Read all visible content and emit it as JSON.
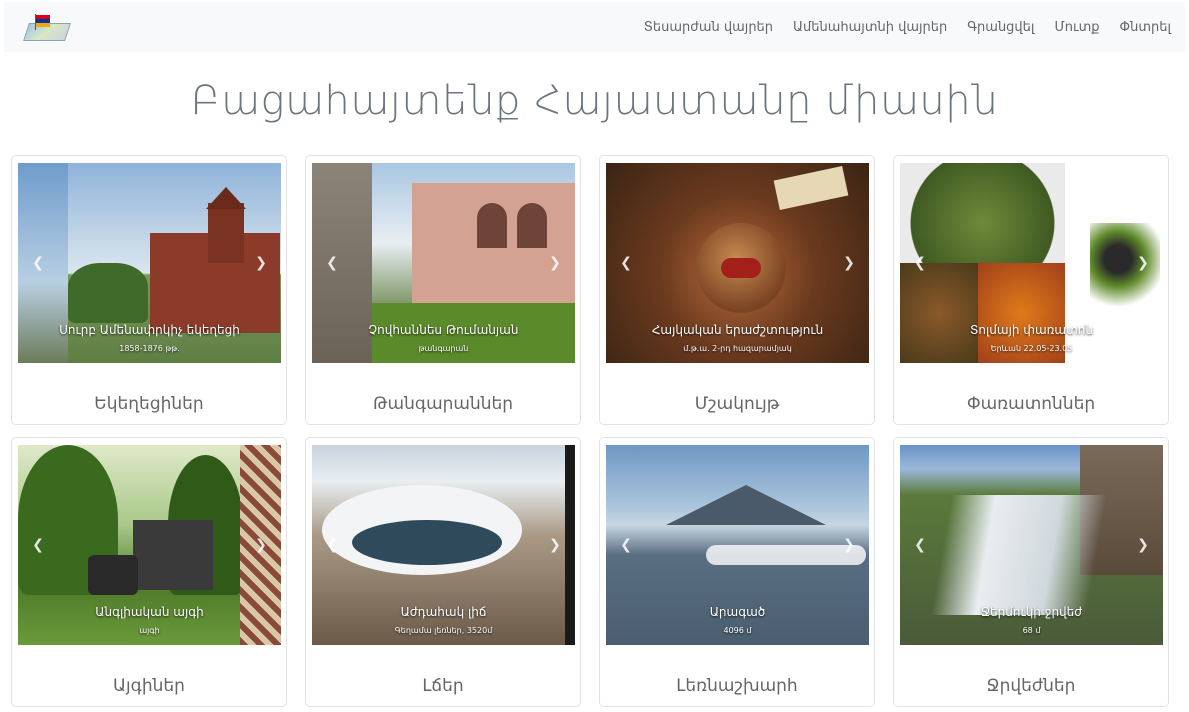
{
  "nav": {
    "links": [
      "Տեսարժան վայրեր",
      "Ամենահայտնի վայրեր",
      "Գրանցվել",
      "Մուտք",
      "Փնտրել"
    ]
  },
  "hero": {
    "title": "Բացահայտենք Հայաստանը միասին"
  },
  "cards": [
    {
      "label": "Եկեղեցիներ",
      "caption_title": "Սուրբ Ամենափրկիչ եկեղեցի",
      "caption_sub": "1858-1876 թթ.",
      "accent": "#8c3b2a"
    },
    {
      "label": "Թանգարաններ",
      "caption_title": "Չովհաննես Թումանյան",
      "caption_sub": "թանգարան",
      "accent": "#c98a7a"
    },
    {
      "label": "Մշակույթ",
      "caption_title": "Հայկական երաժշտություն",
      "caption_sub": "մ.թ.ա. 2-րդ հազարամյակ",
      "accent": "#6b4a2b"
    },
    {
      "label": "Փառատոններ",
      "caption_title": "Տոլմայի փառատոն",
      "caption_sub": "Երևան 22.05-23.05",
      "accent": "#4c6a2a"
    },
    {
      "label": "Այգիներ",
      "caption_title": "Անգլիական այգի",
      "caption_sub": "այգի",
      "accent": "#3f7a2a"
    },
    {
      "label": "Լճեր",
      "caption_title": "Աժդահակ լիճ",
      "caption_sub": "Գեղամա լեռներ, 3520մ",
      "accent": "#2f4a5a"
    },
    {
      "label": "Լեռնաշխարհ",
      "caption_title": "Արագած",
      "caption_sub": "4096 մ",
      "accent": "#3a5a7a"
    },
    {
      "label": "Ջրվեժներ",
      "caption_title": "Ջերմուկի ջրվեժ",
      "caption_sub": "68 մ",
      "accent": "#5a7a3a"
    }
  ],
  "icons": {
    "prev": "chevron-left-icon",
    "next": "chevron-right-icon",
    "logo": "armenia-map-flag-logo"
  },
  "colors": {
    "flag_red": "#d90012",
    "flag_blue": "#0033a0",
    "flag_orange": "#f2a800",
    "navbar_bg": "#f8f9fa"
  }
}
